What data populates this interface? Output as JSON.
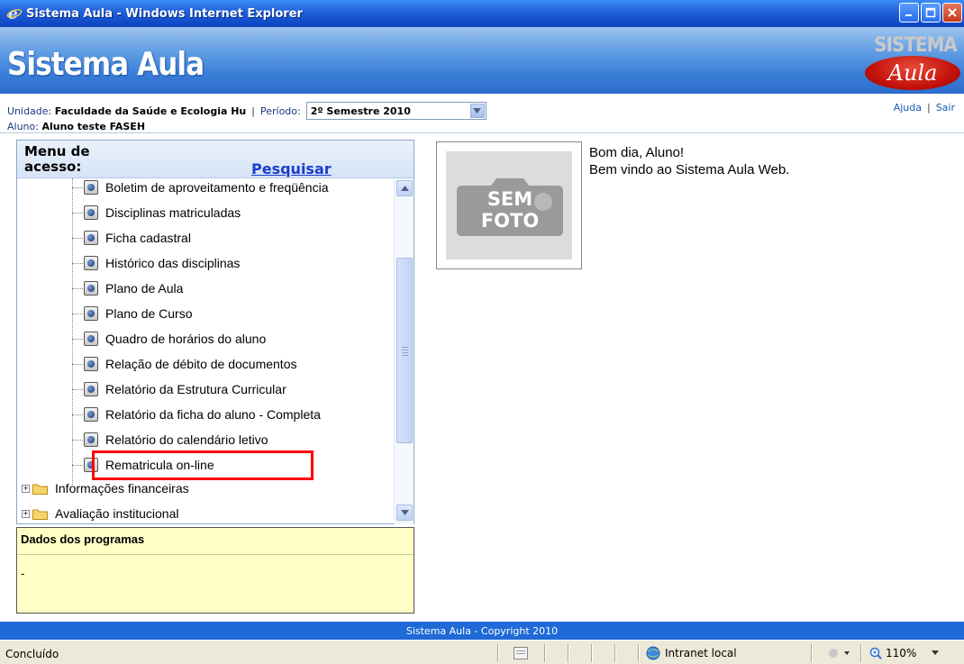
{
  "window": {
    "title": "Sistema Aula - Windows Internet Explorer"
  },
  "banner": {
    "title": "Sistema Aula",
    "logo_top": "SISTEMA",
    "logo_bottom": "Aula"
  },
  "info": {
    "unidade_label": "Unidade:",
    "unidade_value": "Faculdade da Saúde e Ecologia Hu",
    "periodo_label": "Período:",
    "periodo_value": "2º Semestre 2010",
    "aluno_label": "Aluno:",
    "aluno_value": "Aluno teste FASEH",
    "help_link": "Ajuda",
    "exit_link": "Sair"
  },
  "menu": {
    "title": "Menu de acesso:",
    "search_link": "Pesquisar",
    "items": [
      {
        "label": "Boletim de aproveitamento e freqüência"
      },
      {
        "label": "Disciplinas matriculadas"
      },
      {
        "label": "Ficha cadastral"
      },
      {
        "label": "Histórico das disciplinas"
      },
      {
        "label": "Plano de Aula"
      },
      {
        "label": "Plano de Curso"
      },
      {
        "label": "Quadro de horários do aluno"
      },
      {
        "label": "Relação de débito de documentos"
      },
      {
        "label": "Relatório da Estrutura Curricular"
      },
      {
        "label": "Relatório da ficha do aluno - Completa"
      },
      {
        "label": "Relatório do calendário letivo"
      },
      {
        "label": "Rematricula on-line"
      }
    ],
    "folders": [
      {
        "label": "Informações financeiras"
      },
      {
        "label": "Avaliação institucional"
      }
    ]
  },
  "programs": {
    "title": "Dados dos programas",
    "value": "-"
  },
  "photo": {
    "line1": "SEM",
    "line2": "FOTO"
  },
  "welcome": {
    "line1": "Bom dia, Aluno!",
    "line2": "Bem vindo ao Sistema Aula Web."
  },
  "footer": {
    "text": "Sistema Aula - Copyright 2010"
  },
  "statusbar": {
    "status": "Concluído",
    "zone": "Intranet local",
    "zoom": "110%"
  }
}
